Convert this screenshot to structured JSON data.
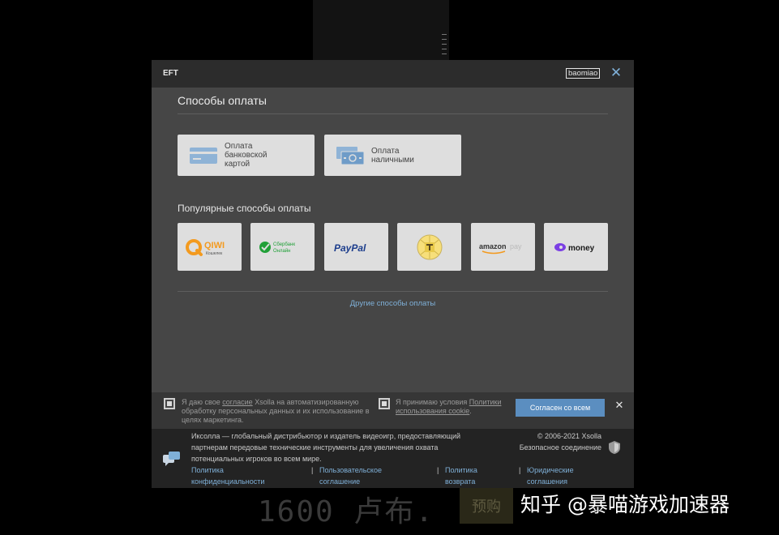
{
  "modal": {
    "title": "EFT",
    "user": "baomiao",
    "close_glyph": "✕",
    "payment_methods_title": "Способы оплаты",
    "methods": [
      {
        "label": "Оплата банковской картой",
        "icon": "credit-card-icon"
      },
      {
        "label": "Оплата наличными",
        "icon": "cash-icon"
      }
    ],
    "popular_title": "Популярные способы оплаты",
    "providers": [
      {
        "name": "QIWI Кошелек",
        "icon": "qiwi-logo",
        "text": "QIWI",
        "subtext": "Кошелек"
      },
      {
        "name": "Сбербанк Онлайн",
        "icon": "sberbank-logo",
        "text": "Сбербанк",
        "subtext": "Онлайн"
      },
      {
        "name": "PayPal",
        "icon": "paypal-logo",
        "text": "PayPal"
      },
      {
        "name": "Tinkoff",
        "icon": "tinkoff-logo"
      },
      {
        "name": "amazon pay",
        "icon": "amazon-pay-logo",
        "text": "amazon",
        "subtext": "pay"
      },
      {
        "name": "money",
        "icon": "yoomoney-logo",
        "text": "money"
      }
    ],
    "other_methods_link": "Другие способы оплаты"
  },
  "consent": {
    "text1_pre": "Я даю свое ",
    "text1_link": "согласие",
    "text1_post": " Xsolla на автоматизированную обработку персональных данных и их использование в целях маркетинга.",
    "text2_pre": "Я принимаю условия ",
    "text2_link": "Политики использования cookie",
    "text2_post": ".",
    "accept_label": "Согласен со всем",
    "close_glyph": "✕"
  },
  "footer": {
    "description": "Иксолла — глобальный дистрибьютор и издатель видеоигр, предоставляющий партнерам передовые технические инструменты для увеличения охвата потенциальных игроков во всем мире.",
    "copyright": "© 2006-2021 Xsolla",
    "secure": "Безопасное соединение",
    "links": [
      "Политика конфиденциальности",
      "Пользовательское соглашение",
      "Политика возврата",
      "Юридические соглашения"
    ],
    "separator": "|"
  },
  "background": {
    "price": "1600 卢布.",
    "preorder": "预购",
    "watermark": "知乎 @暴喵游戏加速器"
  },
  "colors": {
    "accent": "#5b8ec0",
    "link": "#7fb0d8",
    "modal_bg": "#464646",
    "header_bg": "#2c2c2c",
    "footer_bg": "#232323"
  }
}
